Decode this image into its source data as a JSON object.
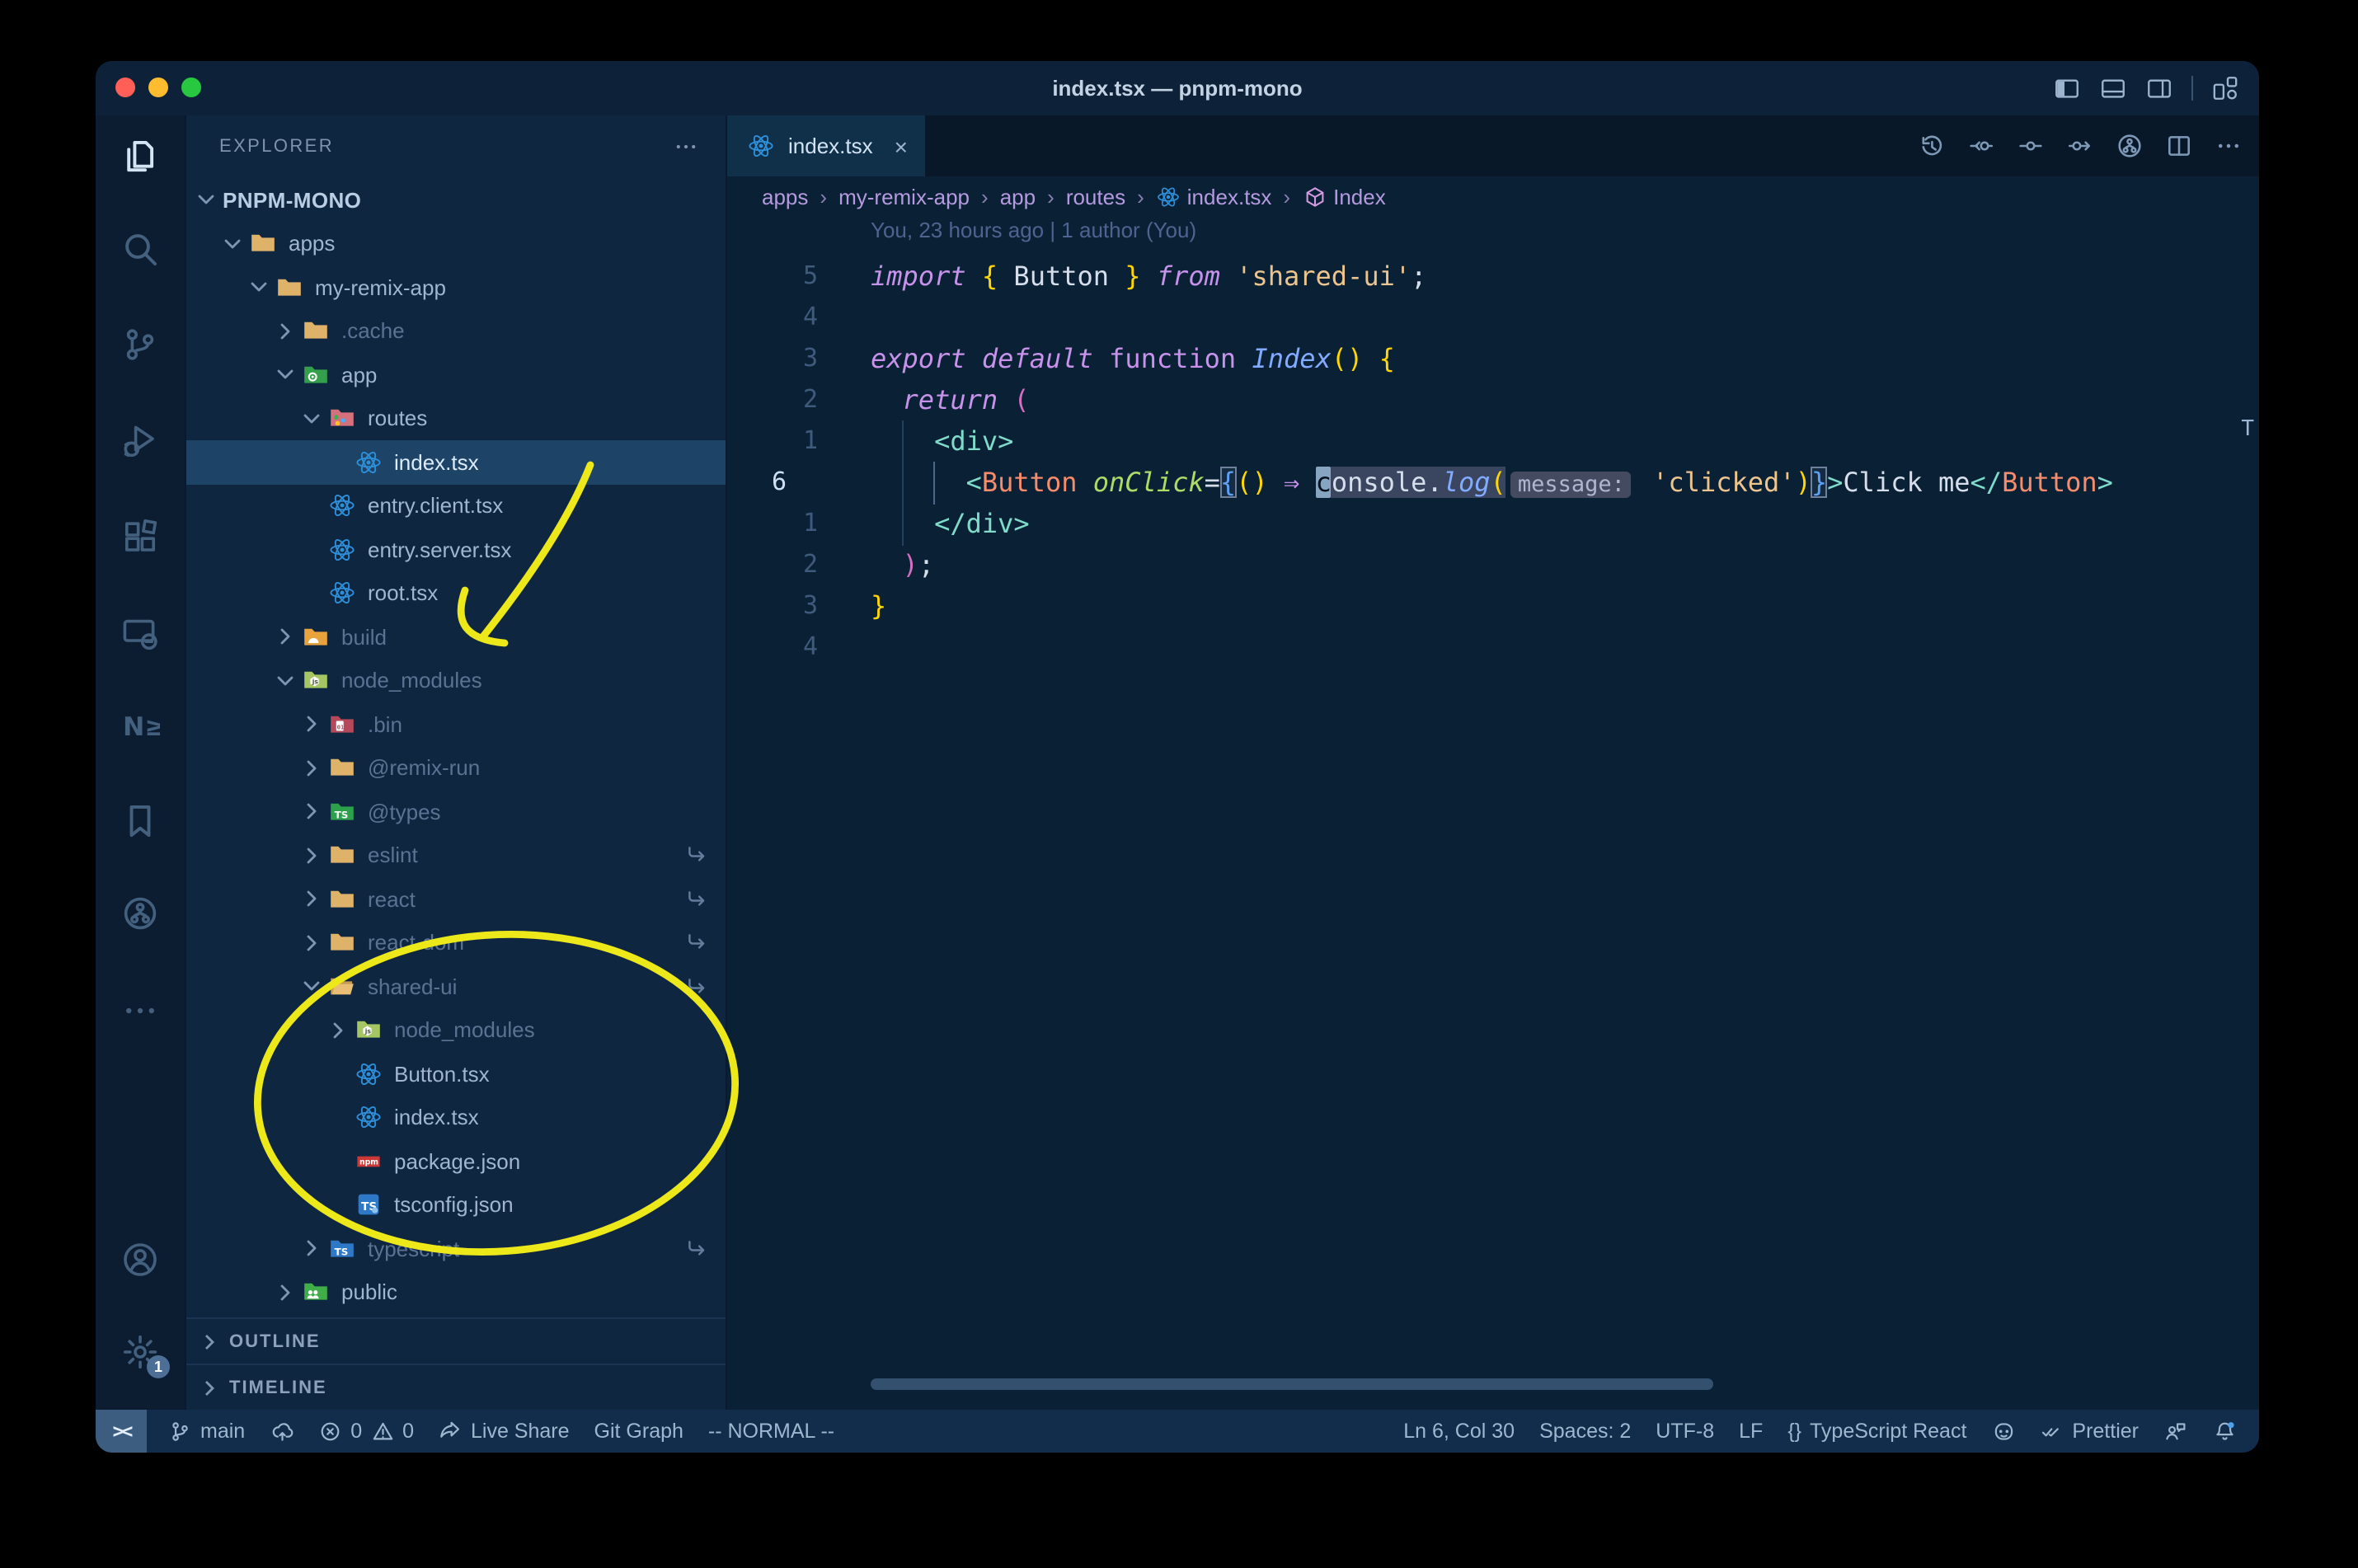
{
  "window": {
    "title": "index.tsx — pnpm-mono"
  },
  "titlebar": {
    "traffic_lights": [
      "#ff5f57",
      "#febc2e",
      "#28c840"
    ],
    "layout_icons": [
      {
        "name": "toggle-primary-sidebar",
        "icon": "sidebar-left"
      },
      {
        "name": "toggle-panel",
        "icon": "panel-bottom"
      },
      {
        "name": "toggle-secondary-sidebar",
        "icon": "sidebar-right"
      },
      {
        "name": "customize-layout",
        "icon": "layouts",
        "sep_before": true
      }
    ]
  },
  "activity_bar": {
    "top": [
      {
        "name": "explorer",
        "icon": "files",
        "active": true
      },
      {
        "name": "search",
        "icon": "search"
      },
      {
        "name": "source-control",
        "icon": "source-control"
      },
      {
        "name": "run-and-debug",
        "icon": "debug"
      },
      {
        "name": "extensions",
        "icon": "extensions"
      },
      {
        "name": "remote-explorer",
        "icon": "remote"
      },
      {
        "name": "nx-console",
        "icon": "nx"
      },
      {
        "name": "bookmarks",
        "icon": "bookmark"
      },
      {
        "name": "git-graph",
        "icon": "branch-circle"
      },
      {
        "name": "additional-views",
        "icon": "more"
      }
    ],
    "bottom": [
      {
        "name": "accounts",
        "icon": "accounts"
      },
      {
        "name": "manage",
        "icon": "gear",
        "badge": "1"
      }
    ]
  },
  "sidebar": {
    "header": "EXPLORER",
    "sections": [
      "OUTLINE",
      "TIMELINE"
    ],
    "tree": [
      {
        "label": "PNPM-MONO",
        "level": 0,
        "chevron": "down",
        "root": true
      },
      {
        "label": "apps",
        "level": 1,
        "icon": "folder",
        "chevron": "down"
      },
      {
        "label": "my-remix-app",
        "level": 2,
        "icon": "folder",
        "chevron": "down"
      },
      {
        "label": ".cache",
        "level": 3,
        "icon": "folder",
        "chevron": "right",
        "dim": true
      },
      {
        "label": "app",
        "level": 3,
        "icon": "folder-app",
        "chevron": "down"
      },
      {
        "label": "routes",
        "level": 4,
        "icon": "folder-routes",
        "chevron": "down"
      },
      {
        "label": "index.tsx",
        "level": 5,
        "icon": "react",
        "selected": true
      },
      {
        "label": "entry.client.tsx",
        "level": 4,
        "icon": "react"
      },
      {
        "label": "entry.server.tsx",
        "level": 4,
        "icon": "react"
      },
      {
        "label": "root.tsx",
        "level": 4,
        "icon": "react"
      },
      {
        "label": "build",
        "level": 3,
        "icon": "folder-dist",
        "chevron": "right",
        "dim": true
      },
      {
        "label": "node_modules",
        "level": 3,
        "icon": "folder-nm",
        "chevron": "down",
        "dim": true
      },
      {
        "label": ".bin",
        "level": 4,
        "icon": "folder-bin",
        "chevron": "right",
        "dim": true
      },
      {
        "label": "@remix-run",
        "level": 4,
        "icon": "folder",
        "chevron": "right",
        "dim": true
      },
      {
        "label": "@types",
        "level": 4,
        "icon": "folder-types",
        "chevron": "right",
        "dim": true
      },
      {
        "label": "eslint",
        "level": 4,
        "icon": "folder",
        "chevron": "right",
        "dim": true,
        "symlink": true
      },
      {
        "label": "react",
        "level": 4,
        "icon": "folder",
        "chevron": "right",
        "dim": true,
        "symlink": true
      },
      {
        "label": "react-dom",
        "level": 4,
        "icon": "folder",
        "chevron": "right",
        "dim": true,
        "symlink": true
      },
      {
        "label": "shared-ui",
        "level": 4,
        "icon": "folder-open",
        "chevron": "down",
        "dim": true,
        "symlink": true
      },
      {
        "label": "node_modules",
        "level": 5,
        "icon": "folder-nm",
        "chevron": "right",
        "dim": true
      },
      {
        "label": "Button.tsx",
        "level": 5,
        "icon": "react"
      },
      {
        "label": "index.tsx",
        "level": 5,
        "icon": "react"
      },
      {
        "label": "package.json",
        "level": 5,
        "icon": "npm"
      },
      {
        "label": "tsconfig.json",
        "level": 5,
        "icon": "tsconfig"
      },
      {
        "label": "typescript",
        "level": 4,
        "icon": "folder-ts",
        "chevron": "right",
        "dim": true,
        "symlink": true
      },
      {
        "label": "public",
        "level": 3,
        "icon": "folder-public",
        "chevron": "right"
      }
    ]
  },
  "editor": {
    "tab": {
      "label": "index.tsx",
      "icon": "react",
      "close": "×"
    },
    "actions": [
      {
        "name": "timeline-history",
        "icon": "history"
      },
      {
        "name": "previous-change",
        "icon": "prev-change"
      },
      {
        "name": "toggle-file-blame",
        "icon": "file-change"
      },
      {
        "name": "next-change",
        "icon": "next-change"
      },
      {
        "name": "git-branch-actions",
        "icon": "branch-circle"
      },
      {
        "name": "split-editor",
        "icon": "split"
      },
      {
        "name": "more-actions",
        "icon": "more"
      }
    ],
    "breadcrumbs": [
      {
        "label": "apps"
      },
      {
        "label": "my-remix-app"
      },
      {
        "label": "app"
      },
      {
        "label": "routes"
      },
      {
        "label": "index.tsx",
        "icon": "react"
      },
      {
        "label": "Index",
        "icon": "symbol-module"
      }
    ],
    "blame": "You, 23 hours ago | 1 author (You)",
    "overview_marker": "T",
    "code_lines": [
      {
        "num": "5",
        "segs": [
          [
            "kw",
            "import"
          ],
          [
            "def",
            " "
          ],
          [
            "brY",
            "{"
          ],
          [
            "def",
            " Button "
          ],
          [
            "brY",
            "}"
          ],
          [
            "def",
            " "
          ],
          [
            "kw",
            "from"
          ],
          [
            "def",
            " "
          ],
          [
            "str",
            "'shared-ui'"
          ],
          [
            "def",
            ";"
          ]
        ]
      },
      {
        "num": "4",
        "segs": []
      },
      {
        "num": "3",
        "segs": [
          [
            "kw",
            "export"
          ],
          [
            "def",
            " "
          ],
          [
            "kw",
            "default"
          ],
          [
            "def",
            " "
          ],
          [
            "kwU",
            "function"
          ],
          [
            "def",
            " "
          ],
          [
            "fn",
            "Index"
          ],
          [
            "brY",
            "()"
          ],
          [
            "def",
            " "
          ],
          [
            "brY",
            "{"
          ]
        ]
      },
      {
        "num": "2",
        "segs": [
          [
            "def",
            "  "
          ],
          [
            "kw",
            "return"
          ],
          [
            "def",
            " "
          ],
          [
            "brP",
            "("
          ]
        ]
      },
      {
        "num": "1",
        "segs": [
          [
            "def",
            "    "
          ],
          [
            "tag",
            "<div>"
          ]
        ]
      },
      {
        "num": "6",
        "cur": true,
        "segs": [
          [
            "def",
            "      "
          ],
          [
            "tag",
            "<"
          ],
          [
            "comp",
            "Button"
          ],
          [
            "def",
            " "
          ],
          [
            "attr",
            "onClick"
          ],
          [
            "def",
            "="
          ],
          [
            "brB box",
            "{"
          ],
          [
            "brY",
            "()"
          ],
          [
            "def",
            " "
          ],
          [
            "kw",
            "⇒"
          ],
          [
            "def",
            " "
          ],
          [
            "cursor",
            "c"
          ],
          [
            "def occ",
            "onsole."
          ],
          [
            "fn occ",
            "log"
          ],
          [
            "brY occ",
            "("
          ],
          [
            "inlay",
            "message:"
          ],
          [
            "def",
            " "
          ],
          [
            "str",
            "'clicked'"
          ],
          [
            "brY",
            ")"
          ],
          [
            "brB box",
            "}"
          ],
          [
            "tag",
            ">"
          ],
          [
            "def",
            "Click me"
          ],
          [
            "tag",
            "</"
          ],
          [
            "comp",
            "Button"
          ],
          [
            "tag",
            ">"
          ]
        ]
      },
      {
        "num": "1",
        "segs": [
          [
            "def",
            "    "
          ],
          [
            "tag",
            "</div>"
          ]
        ]
      },
      {
        "num": "2",
        "segs": [
          [
            "def",
            "  "
          ],
          [
            "brP",
            ")"
          ],
          [
            "def",
            ";"
          ]
        ]
      },
      {
        "num": "3",
        "segs": [
          [
            "brY",
            "}"
          ]
        ]
      },
      {
        "num": "4",
        "segs": []
      }
    ]
  },
  "status_bar": {
    "left": [
      {
        "name": "remote-indicator",
        "box": true,
        "parts": [
          {
            "text": "><"
          }
        ]
      },
      {
        "name": "git-branch",
        "parts": [
          {
            "icon": "branch"
          },
          {
            "text": "main"
          }
        ]
      },
      {
        "name": "publish-changes",
        "parts": [
          {
            "icon": "cloud-upload"
          }
        ]
      },
      {
        "name": "problems",
        "parts": [
          {
            "icon": "error"
          },
          {
            "text": "0"
          },
          {
            "icon": "warning"
          },
          {
            "text": "0"
          }
        ]
      },
      {
        "name": "live-share",
        "parts": [
          {
            "icon": "live-share"
          },
          {
            "text": "Live Share"
          }
        ]
      },
      {
        "name": "git-graph",
        "parts": [
          {
            "text": "Git Graph"
          }
        ]
      },
      {
        "name": "vim-mode",
        "parts": [
          {
            "text": "-- NORMAL --"
          }
        ]
      }
    ],
    "right": [
      {
        "name": "cursor-position",
        "parts": [
          {
            "text": "Ln 6, Col 30"
          }
        ]
      },
      {
        "name": "indentation",
        "parts": [
          {
            "text": "Spaces: 2"
          }
        ]
      },
      {
        "name": "encoding",
        "parts": [
          {
            "text": "UTF-8"
          }
        ]
      },
      {
        "name": "eol",
        "parts": [
          {
            "text": "LF"
          }
        ]
      },
      {
        "name": "language-mode",
        "parts": [
          {
            "text": "{}"
          },
          {
            "text": "TypeScript React"
          }
        ]
      },
      {
        "name": "github",
        "parts": [
          {
            "icon": "octoface"
          }
        ]
      },
      {
        "name": "formatter-prettier",
        "parts": [
          {
            "icon": "double-check"
          },
          {
            "text": "Prettier"
          }
        ]
      },
      {
        "name": "feedback",
        "parts": [
          {
            "icon": "feedback"
          }
        ]
      },
      {
        "name": "notifications",
        "parts": [
          {
            "icon": "bell-dot"
          }
        ]
      }
    ]
  },
  "annotations": {
    "color": "#ece81a",
    "shapes": [
      "arrow-to-node_modules",
      "circle-around-shared-ui-files"
    ]
  }
}
